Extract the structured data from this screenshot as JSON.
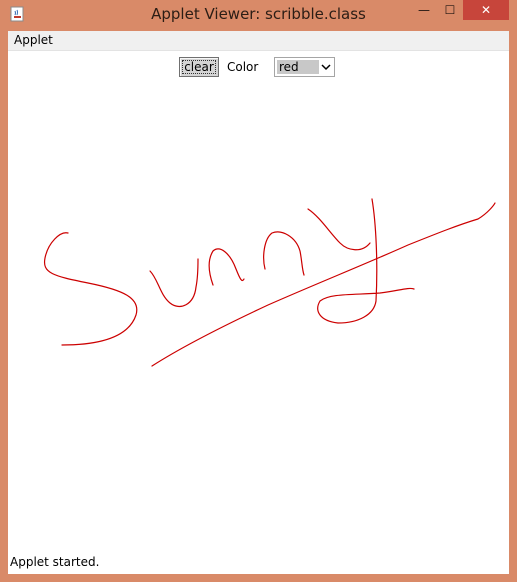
{
  "window": {
    "title": "Applet Viewer: scribble.class",
    "controls": {
      "minimize": "—",
      "maximize": "☐",
      "close": "✕"
    }
  },
  "menubar": {
    "items": [
      "Applet"
    ]
  },
  "toolbar": {
    "clear_label": "clear",
    "color_label": "Color",
    "color_selected": "red"
  },
  "canvas": {
    "stroke_color": "#cc0000",
    "drawing": "Sunny scribble"
  },
  "status": {
    "text": "Applet started."
  },
  "colors": {
    "frame": "#d98a68",
    "close_button": "#c7453b",
    "ink": "#cc0000"
  }
}
